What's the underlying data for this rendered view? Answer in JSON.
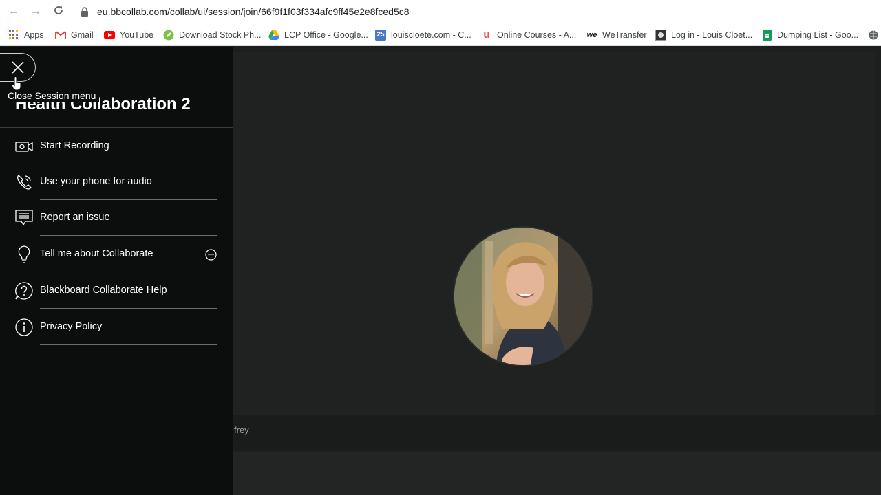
{
  "browser": {
    "url": "eu.bbcollab.com/collab/ui/session/join/66f9f1f03f334afc9ff45e2e8fced5c8",
    "bookmarks": [
      {
        "label": "Apps",
        "icon": "apps-grid-icon"
      },
      {
        "label": "Gmail",
        "icon": "gmail-icon"
      },
      {
        "label": "YouTube",
        "icon": "youtube-icon"
      },
      {
        "label": "Download Stock Ph...",
        "icon": "leaf-icon"
      },
      {
        "label": "LCP Office - Google...",
        "icon": "google-drive-icon"
      },
      {
        "label": "louiscloete.com - C...",
        "icon": "calendar-icon"
      },
      {
        "label": "Online Courses - A...",
        "icon": "udemy-icon"
      },
      {
        "label": "WeTransfer",
        "icon": "wetransfer-icon"
      },
      {
        "label": "Log in - Louis Cloet...",
        "icon": "site-icon"
      },
      {
        "label": "Dumping List - Goo...",
        "icon": "google-sheets-icon"
      }
    ]
  },
  "session_menu": {
    "title": "Health Collaboration 2",
    "close_tooltip": "Close Session menu",
    "items": [
      {
        "label": "Start Recording",
        "icon": "record-camera-icon"
      },
      {
        "label": "Use your phone for audio",
        "icon": "phone-audio-icon"
      },
      {
        "label": "Report an issue",
        "icon": "report-issue-icon"
      },
      {
        "label": "Tell me about Collaborate",
        "icon": "lightbulb-icon"
      },
      {
        "label": "Blackboard Collaborate Help",
        "icon": "help-icon"
      },
      {
        "label": "Privacy Policy",
        "icon": "info-icon"
      }
    ]
  },
  "stage": {
    "participant_name": "frey"
  },
  "colors": {
    "panel_bg": "#0c0d0d",
    "stage_bg": "#202221",
    "text": "#ffffff"
  }
}
